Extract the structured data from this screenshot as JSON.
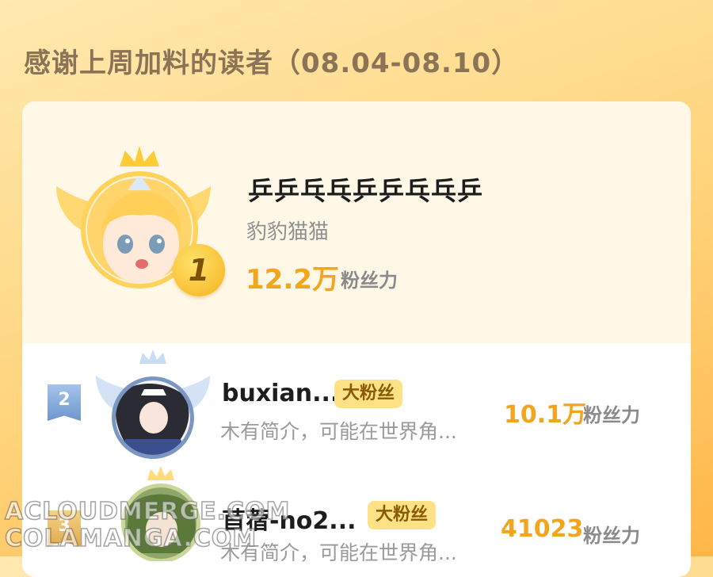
{
  "heading": "感谢上周加料的读者（08.04-08.10）",
  "top_reader": {
    "rank": "1",
    "name": "乒乒乓乓乒乒乓乓乒",
    "subtitle": "豹豹猫猫",
    "fan_value": "12.2万",
    "fan_unit": "粉丝力"
  },
  "readers": [
    {
      "rank": "2",
      "name": "buxian...",
      "badge": "大粉丝",
      "description": "木有简介，可能在世界角...",
      "fan_value": "10.1万",
      "fan_unit": "粉丝力"
    },
    {
      "rank": "3",
      "name": "苜蓿-no2...",
      "badge": "大粉丝",
      "description": "木有简介，可能在世界角...",
      "fan_value": "41023",
      "fan_unit": "粉丝力"
    }
  ],
  "watermark": [
    "ACLOUDMERGE.COM",
    "COLAMANGA.COM"
  ],
  "colors": {
    "accent": "#f2a51d",
    "badge_bg": "#ffe187",
    "rank2": "#6d95cf"
  }
}
